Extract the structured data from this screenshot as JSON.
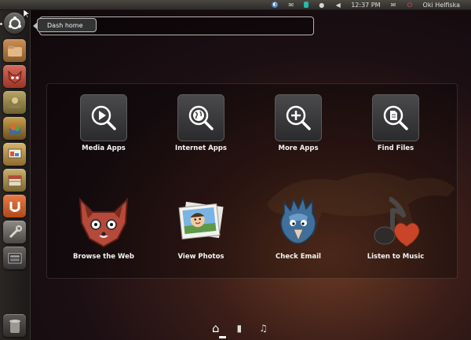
{
  "top_panel": {
    "time": "12:37 PM",
    "user": "Oki Helfiska",
    "indicators": [
      "network-icon",
      "mail-icon",
      "battery-icon",
      "sound-icon"
    ]
  },
  "launcher": {
    "items": [
      {
        "name": "dash-home-button",
        "icon": "ubuntu-logo-icon"
      },
      {
        "name": "home-folder-button",
        "icon": "folder-icon"
      },
      {
        "name": "firefox-button",
        "icon": "firefox-icon"
      },
      {
        "name": "app-launcher-3",
        "icon": "app-icon"
      },
      {
        "name": "app-launcher-4",
        "icon": "app-icon"
      },
      {
        "name": "app-launcher-5",
        "icon": "presentation-icon"
      },
      {
        "name": "app-launcher-6",
        "icon": "calendar-icon"
      },
      {
        "name": "software-center-button",
        "icon": "software-center-icon"
      },
      {
        "name": "system-settings-button",
        "icon": "wrench-icon"
      },
      {
        "name": "workspace-switcher-button",
        "icon": "workspace-icon"
      },
      {
        "name": "trash-button",
        "icon": "trash-icon"
      }
    ]
  },
  "tooltip": "Dash home",
  "search": {
    "value": "",
    "placeholder": ""
  },
  "categories": [
    {
      "label": "Media Apps",
      "icon": "play-search-icon"
    },
    {
      "label": "Internet Apps",
      "icon": "globe-search-icon"
    },
    {
      "label": "More Apps",
      "icon": "plus-search-icon"
    },
    {
      "label": "Find Files",
      "icon": "file-search-icon"
    }
  ],
  "shortcuts": [
    {
      "label": "Browse the Web",
      "icon": "fox-icon"
    },
    {
      "label": "View Photos",
      "icon": "photos-icon"
    },
    {
      "label": "Check Email",
      "icon": "bird-icon"
    },
    {
      "label": "Listen to Music",
      "icon": "music-note-heart-icon"
    }
  ],
  "bottom_nav": [
    {
      "name": "home-lens-icon",
      "glyph": "⌂"
    },
    {
      "name": "files-lens-icon",
      "glyph": "▮"
    },
    {
      "name": "music-lens-icon",
      "glyph": "♫"
    }
  ]
}
